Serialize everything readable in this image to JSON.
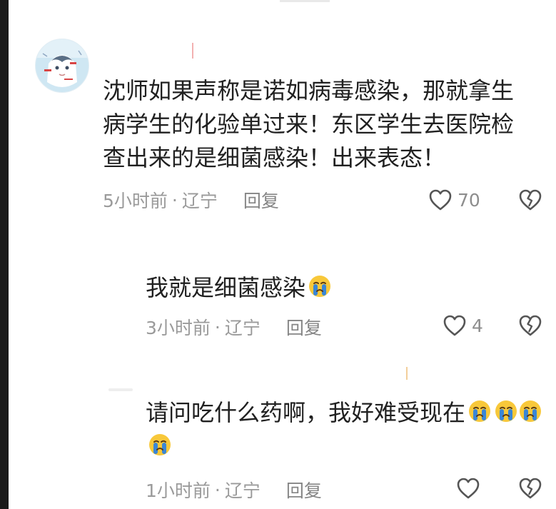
{
  "comments": [
    {
      "text": "沈师如果声称是诺如病毒感染，那就拿生病学生的化验单过来！东区学生去医院检查出来的是细菌感染！出来表态！",
      "lines": [
        "沈师如果声称是诺如病毒感染，那就拿生",
        "病学生的化验单过来！东区学生去医院检",
        "查出来的是细菌感染！出来表态！"
      ],
      "time": "5小时前",
      "separator": "·",
      "location": "辽宁",
      "reply_label": "回复",
      "like_count": "70"
    },
    {
      "text": "我就是细菌感染",
      "emoji_count": 1,
      "time": "3小时前",
      "separator": "·",
      "location": "辽宁",
      "reply_label": "回复",
      "like_count": "4"
    },
    {
      "text": "请问吃什么药啊，我好难受现在",
      "emoji_count": 4,
      "time": "1小时前",
      "separator": "·",
      "location": "辽宁",
      "reply_label": "回复",
      "like_count": ""
    }
  ],
  "icons": {
    "avatar": "anime-avatar",
    "like": "heart-outline-icon",
    "dislike": "broken-heart-icon",
    "emoji": "crying-face-emoji"
  },
  "colors": {
    "text_primary": "#202020",
    "text_meta": "#9a9a9a",
    "emoji_yellow": "#f8c83a",
    "emoji_tears": "#3a86d6"
  }
}
